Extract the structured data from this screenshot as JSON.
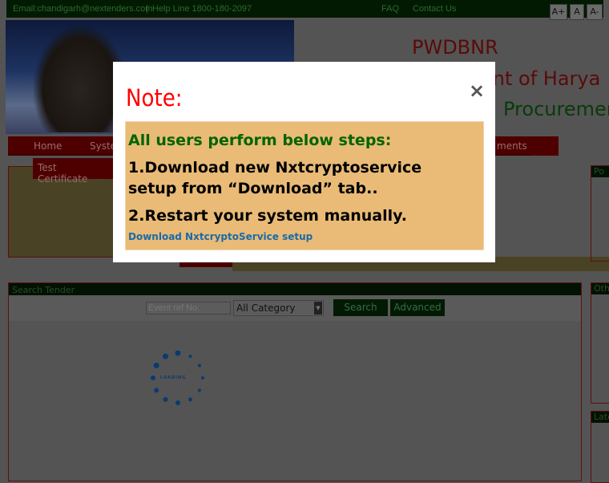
{
  "topbar": {
    "email": "Email:chandigarh@nextenders.com",
    "separator": "|",
    "helpline": "Help Line 1800-180-2097",
    "faq": "FAQ",
    "contact": "Contact Us",
    "font_buttons": [
      "A+",
      "A",
      "A-"
    ]
  },
  "header": {
    "line1": "PWDBNR",
    "line2": "ent of Harya",
    "line3": "Procuremen"
  },
  "nav": {
    "items": [
      "Home",
      "Syste",
      "ments"
    ],
    "dropdown_item": "Test Certificate"
  },
  "side_panels": [
    "Po",
    "Oth",
    "Late"
  ],
  "search": {
    "title": "Search Tender",
    "input_placeholder": "Event ref No.",
    "category_selected": "All Category",
    "search_button": "Search",
    "advanced_button": "Advanced",
    "loading": "LOADING"
  },
  "modal": {
    "title": "Note:",
    "heading": "All users perform below steps:",
    "step1": "1.Download new Nxtcryptoservice setup from “Download” tab..",
    "step2": "2.Restart your system manually.",
    "link": "Download NxtcryptoService setup"
  },
  "colors": {
    "note_title": "#ff0000",
    "heading": "#006400",
    "box_bg": "#e9bb77",
    "link": "#1a6aa8"
  }
}
